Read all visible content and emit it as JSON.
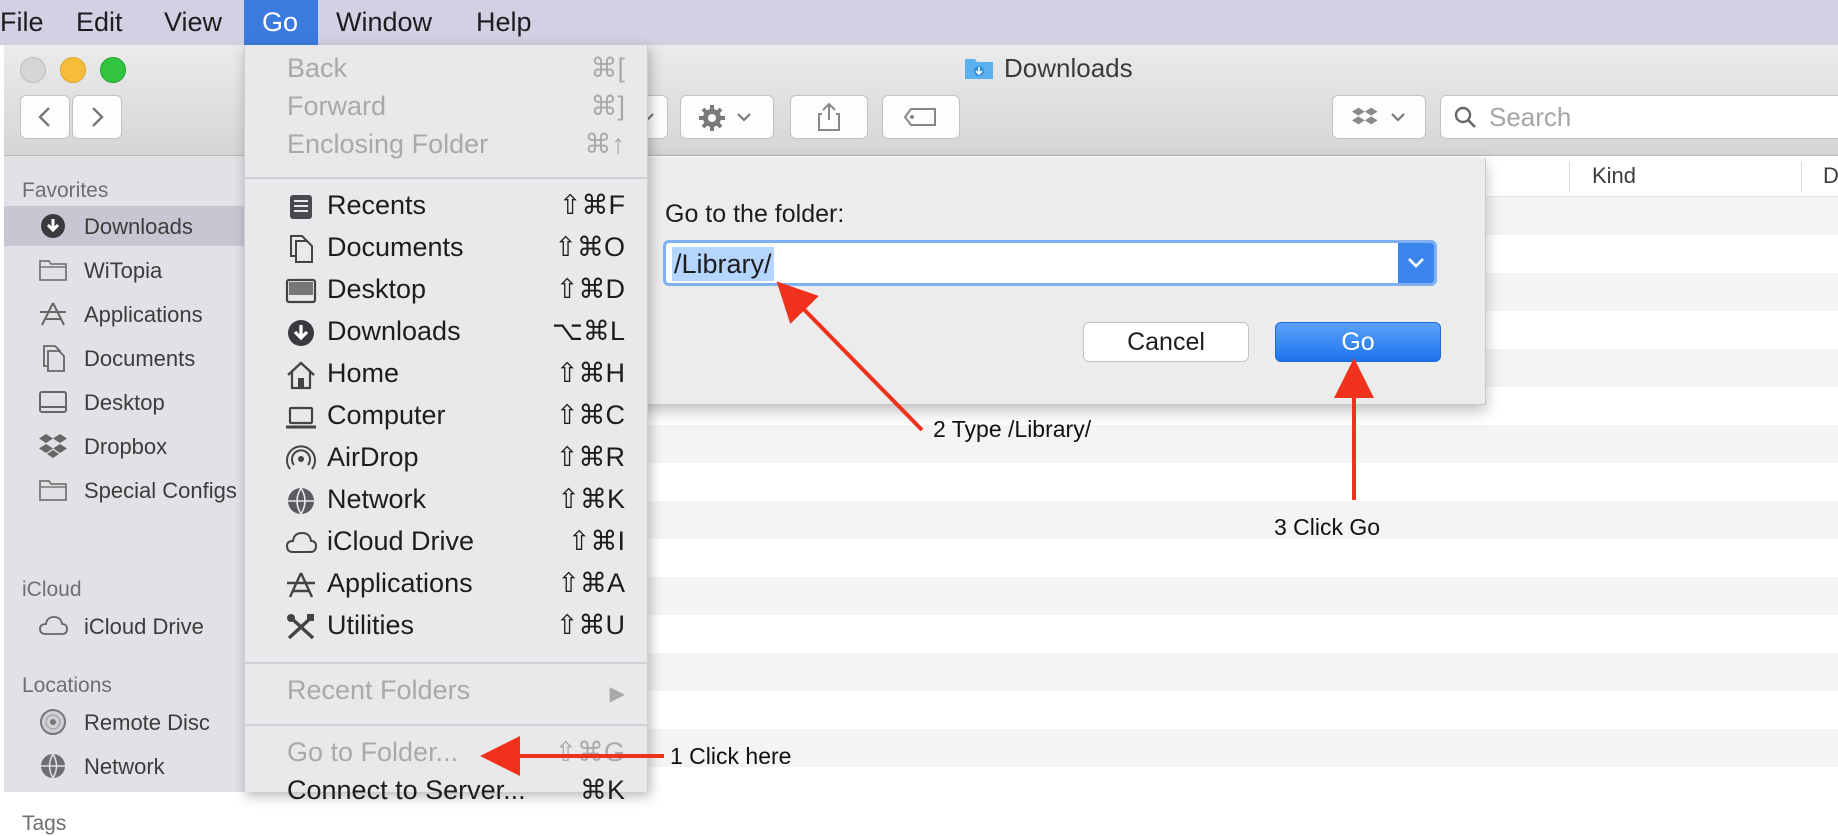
{
  "menubar": {
    "items": [
      {
        "label": "File"
      },
      {
        "label": "Edit"
      },
      {
        "label": "View"
      },
      {
        "label": "Go"
      },
      {
        "label": "Window"
      },
      {
        "label": "Help"
      }
    ]
  },
  "window": {
    "title": "Downloads",
    "search_placeholder": "Search"
  },
  "sidebar": {
    "favorites_heading": "Favorites",
    "favorites": [
      {
        "label": "Downloads",
        "icon": "downloads-icon"
      },
      {
        "label": "WiTopia",
        "icon": "folder-icon"
      },
      {
        "label": "Applications",
        "icon": "applications-icon"
      },
      {
        "label": "Documents",
        "icon": "documents-icon"
      },
      {
        "label": "Desktop",
        "icon": "desktop-icon"
      },
      {
        "label": "Dropbox",
        "icon": "dropbox-icon"
      },
      {
        "label": "Special Configs",
        "icon": "folder-icon"
      }
    ],
    "icloud_heading": "iCloud",
    "icloud": [
      {
        "label": "iCloud Drive",
        "icon": "cloud-icon"
      }
    ],
    "locations_heading": "Locations",
    "locations": [
      {
        "label": "Remote Disc",
        "icon": "disc-icon"
      },
      {
        "label": "Network",
        "icon": "network-icon"
      }
    ],
    "tags_heading": "Tags"
  },
  "list": {
    "columns": [
      "Kind",
      "Da"
    ]
  },
  "go_menu": {
    "back": {
      "label": "Back",
      "shortcut": "⌘["
    },
    "forward": {
      "label": "Forward",
      "shortcut": "⌘]"
    },
    "enclosing": {
      "label": "Enclosing Folder",
      "shortcut": "⌘↑"
    },
    "places": [
      {
        "label": "Recents",
        "shortcut": "⇧⌘F",
        "icon": "recents-icon"
      },
      {
        "label": "Documents",
        "shortcut": "⇧⌘O",
        "icon": "documents-icon"
      },
      {
        "label": "Desktop",
        "shortcut": "⇧⌘D",
        "icon": "desktop-icon"
      },
      {
        "label": "Downloads",
        "shortcut": "⌥⌘L",
        "icon": "downloads-icon"
      },
      {
        "label": "Home",
        "shortcut": "⇧⌘H",
        "icon": "home-icon"
      },
      {
        "label": "Computer",
        "shortcut": "⇧⌘C",
        "icon": "computer-icon"
      },
      {
        "label": "AirDrop",
        "shortcut": "⇧⌘R",
        "icon": "airdrop-icon"
      },
      {
        "label": "Network",
        "shortcut": "⇧⌘K",
        "icon": "network-icon"
      },
      {
        "label": "iCloud Drive",
        "shortcut": "⇧⌘I",
        "icon": "cloud-icon"
      },
      {
        "label": "Applications",
        "shortcut": "⇧⌘A",
        "icon": "applications-icon"
      },
      {
        "label": "Utilities",
        "shortcut": "⇧⌘U",
        "icon": "utilities-icon"
      }
    ],
    "recent_folders": {
      "label": "Recent Folders",
      "arrow": "▶"
    },
    "go_to_folder": {
      "label": "Go to Folder...",
      "shortcut": "⇧⌘G"
    },
    "connect": {
      "label": "Connect to Server...",
      "shortcut": "⌘K"
    }
  },
  "dialog": {
    "label": "Go to the folder:",
    "path_value": "/Library/",
    "cancel_label": "Cancel",
    "go_label": "Go"
  },
  "annotations": {
    "step1": "1  Click here",
    "step2": "2  Type /Library/",
    "step3": "3  Click Go"
  },
  "colors": {
    "accent": "#3b7be0",
    "arrow": "#f0321c",
    "menubar": "#d2d0e3"
  }
}
